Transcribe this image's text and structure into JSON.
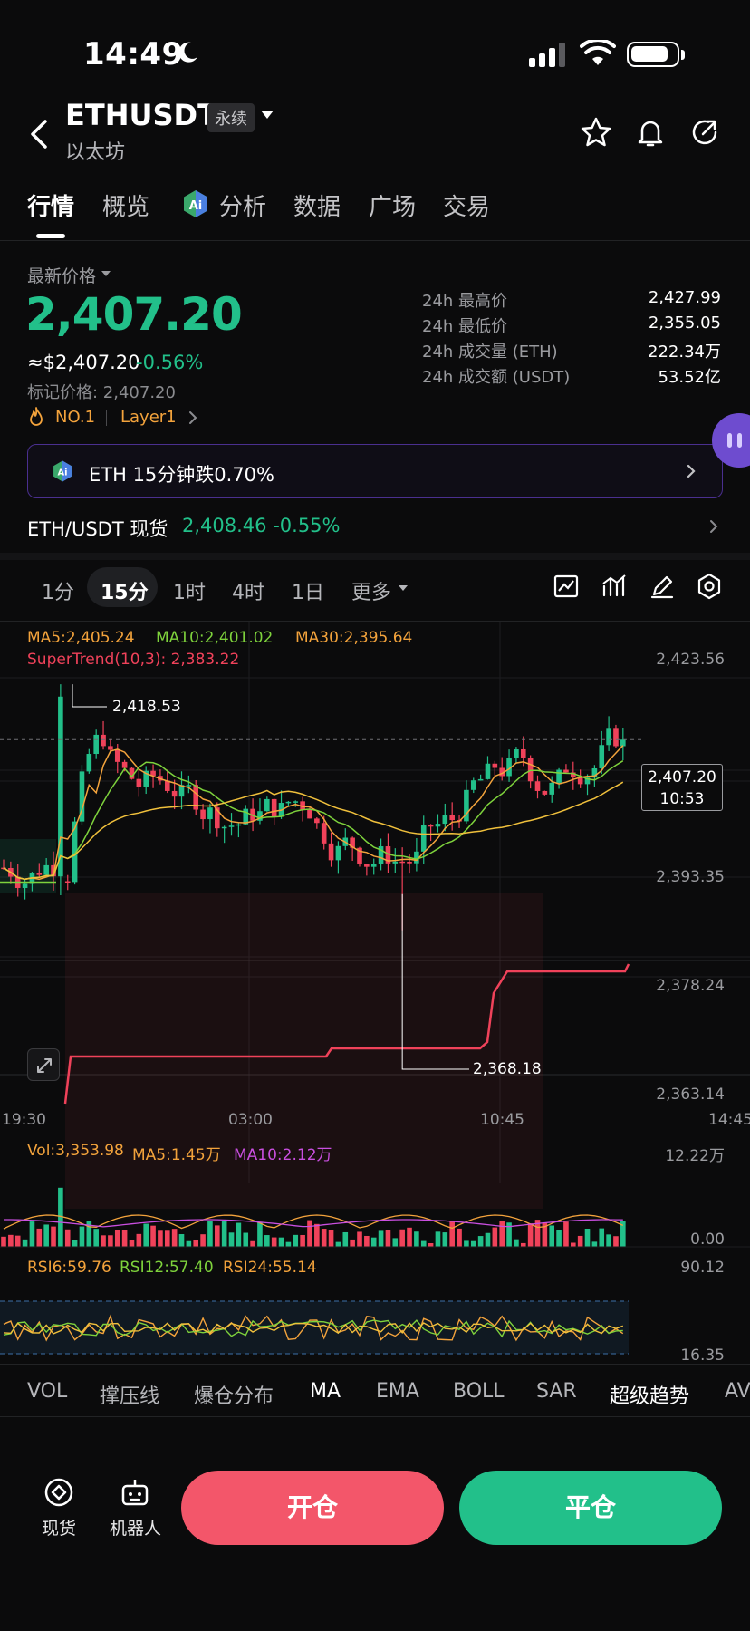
{
  "status_bar": {
    "time": "14:49"
  },
  "header": {
    "pair": "ETHUSDT",
    "contract_badge": "永续",
    "subtitle": "以太坊"
  },
  "tabs": [
    {
      "label": "行情",
      "active": true
    },
    {
      "label": "概览"
    },
    {
      "label": "分析"
    },
    {
      "label": "数据"
    },
    {
      "label": "广场"
    },
    {
      "label": "交易"
    }
  ],
  "price": {
    "label": "最新价格",
    "last": "2,407.20",
    "usd": "≈$2,407.20",
    "change_pct": "-0.56%",
    "mark": "标记价格: 2,407.20",
    "tag_rank": "NO.1",
    "tag_sector": "Layer1"
  },
  "stats": [
    {
      "label": "24h 最高价",
      "value": "2,427.99"
    },
    {
      "label": "24h 最低价",
      "value": "2,355.05"
    },
    {
      "label": "24h 成交量 (ETH)",
      "value": "222.34万"
    },
    {
      "label": "24h 成交额 (USDT)",
      "value": "53.52亿"
    }
  ],
  "ai_banner": {
    "text": "ETH 15分钟跌0.70%"
  },
  "spot": {
    "label": "ETH/USDT 现货",
    "price": "2,408.46",
    "change": "-0.55%"
  },
  "timeframes": [
    {
      "label": "1分"
    },
    {
      "label": "15分",
      "active": true
    },
    {
      "label": "1时"
    },
    {
      "label": "4时"
    },
    {
      "label": "1日"
    },
    {
      "label": "更多"
    }
  ],
  "chart_legend": {
    "ma5": "MA5:2,405.24",
    "ma10": "MA10:2,401.02",
    "ma30": "MA30:2,395.64",
    "supertrend": "SuperTrend(10,3): 2,383.22"
  },
  "price_axis": [
    "2,423.56",
    "2,393.35",
    "2,378.24",
    "2,363.14"
  ],
  "time_axis": [
    "19:30",
    "03:00",
    "10:45",
    "14:45"
  ],
  "high_marker": "2,418.53",
  "low_marker": "2,368.18",
  "current_tag": {
    "price": "2,407.20",
    "countdown": "10:53"
  },
  "volume_legend": {
    "vol": "Vol:3,353.98",
    "ma5": "MA5:1.45万",
    "ma10": "MA10:2.12万"
  },
  "volume_axis": [
    "12.22万",
    "0.00"
  ],
  "rsi_legend": {
    "rsi6": "RSI6:59.76",
    "rsi12": "RSI12:57.40",
    "rsi24": "RSI24:55.14"
  },
  "rsi_axis": [
    "90.12",
    "16.35"
  ],
  "indicators": [
    {
      "label": "VOL"
    },
    {
      "label": "撑压线"
    },
    {
      "label": "爆仓分布"
    },
    {
      "label": "MA",
      "on": true
    },
    {
      "label": "EMA"
    },
    {
      "label": "BOLL"
    },
    {
      "label": "SAR"
    },
    {
      "label": "超级趋势",
      "on": true
    },
    {
      "label": "AV"
    }
  ],
  "bottom_bar": {
    "spot_label": "现货",
    "bot_label": "机器人",
    "open_label": "开仓",
    "close_label": "平仓"
  },
  "colors": {
    "up": "#22c08a",
    "down": "#f0425a",
    "ma5": "#f3a33c",
    "ma10": "#7ed23c",
    "ma30": "#f3a33c"
  },
  "chart_data": {
    "type": "candlestick",
    "y_range": [
      2363.14,
      2423.56
    ],
    "high": 2418.53,
    "low": 2368.18,
    "last": 2407.2
  }
}
